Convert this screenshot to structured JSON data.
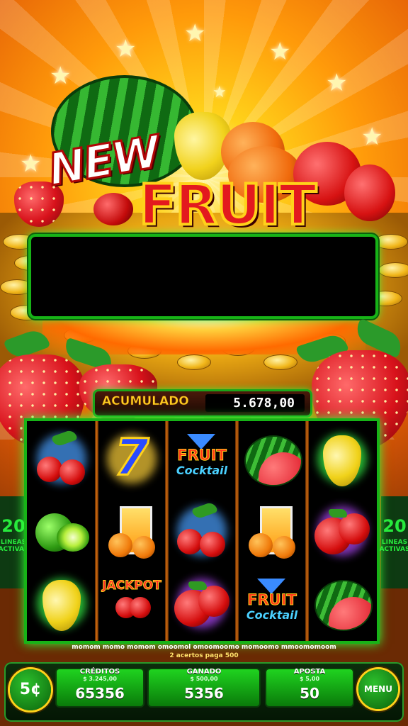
{
  "logo": {
    "new": "NEW",
    "fruit": "FRUIT"
  },
  "jackpot": {
    "label": "ACUMULADO",
    "value": "5.678,00"
  },
  "lines": {
    "left_count": "20",
    "left_text": "LINEAS ACTIVAS",
    "right_count": "20",
    "right_text": "LINEAS ACTIVAS"
  },
  "reels": [
    [
      "cherries-icon",
      "lime-icon",
      "pear-icon"
    ],
    [
      "seven-icon",
      "orange-juice-icon",
      "jackpot-strawberries-icon"
    ],
    [
      "fruit-cocktail-icon",
      "cherries-icon",
      "apples-icon"
    ],
    [
      "watermelon-icon",
      "orange-juice-icon",
      "fruit-cocktail-icon"
    ],
    [
      "pear-icon",
      "apples-icon",
      "watermelon-icon"
    ]
  ],
  "symbol_text": {
    "seven": "7",
    "jackpot": "JACKPOT",
    "fruit": "FRUIT",
    "cocktail": "Cocktail"
  },
  "messages": {
    "line1": "momom momo momom omoomol omoomoomo momoomo mmoomomoom",
    "line2": "2 acertos paga 500"
  },
  "controls": {
    "denomination": "5¢",
    "credits": {
      "title": "CRÉDITOS",
      "sub": "$ 3.245,00",
      "value": "65356"
    },
    "won": {
      "title": "GANADO",
      "sub": "$ 500,00",
      "value": "5356"
    },
    "bet": {
      "title": "APOSTA",
      "sub": "$ 5,00",
      "value": "50"
    },
    "menu": "MENU"
  },
  "colors": {
    "accent_green": "#17b317",
    "gold": "#ffd21a",
    "fruit_red": "#e3191e"
  }
}
